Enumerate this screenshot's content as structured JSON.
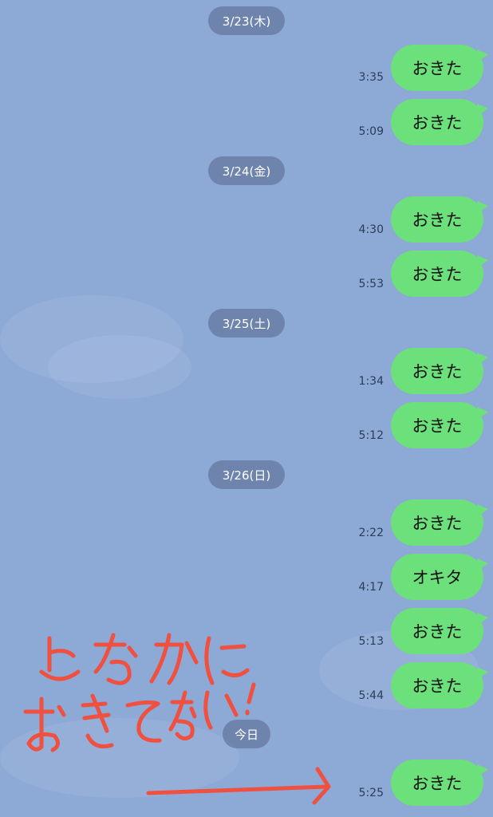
{
  "conversation": [
    {
      "date": "3/23(木)",
      "messages": [
        {
          "time": "3:35",
          "text": "おきた"
        },
        {
          "time": "5:09",
          "text": "おきた"
        }
      ]
    },
    {
      "date": "3/24(金)",
      "messages": [
        {
          "time": "4:30",
          "text": "おきた"
        },
        {
          "time": "5:53",
          "text": "おきた"
        }
      ]
    },
    {
      "date": "3/25(土)",
      "messages": [
        {
          "time": "1:34",
          "text": "おきた"
        },
        {
          "time": "5:12",
          "text": "おきた"
        }
      ]
    },
    {
      "date": "3/26(日)",
      "messages": [
        {
          "time": "2:22",
          "text": "おきた"
        },
        {
          "time": "4:17",
          "text": "オキタ"
        },
        {
          "time": "5:13",
          "text": "おきた"
        },
        {
          "time": "5:44",
          "text": "おきた"
        }
      ]
    },
    {
      "date": "今日",
      "messages": [
        {
          "time": "5:25",
          "text": "おきた"
        }
      ]
    }
  ],
  "handwritten_note": {
    "line1": "よなかに",
    "line2": "おきてない!"
  },
  "colors": {
    "background": "#8da9d6",
    "bubble": "#6ce07a",
    "annotation": "#f0503f"
  }
}
